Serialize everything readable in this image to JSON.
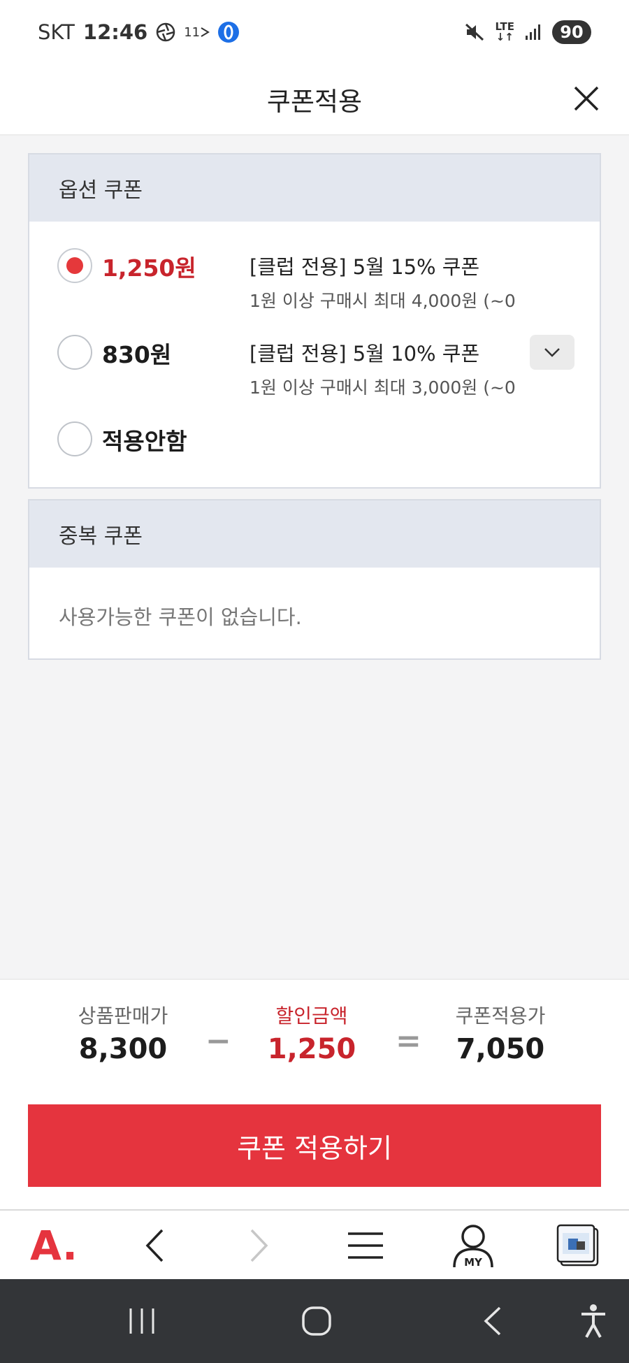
{
  "status_bar": {
    "carrier": "SKT",
    "time": "12:46",
    "app_icon_label": "11",
    "network": "LTE",
    "battery": "90",
    "icons": [
      "aperture-icon",
      "eleven-street-icon",
      "opera-icon",
      "mute-icon",
      "lte-icon",
      "signal-icon",
      "battery-icon"
    ]
  },
  "header": {
    "title": "쿠폰적용",
    "close_icon": "close-icon"
  },
  "option_coupon": {
    "title": "옵션 쿠폰",
    "options": [
      {
        "amount": "1,250원",
        "name": "[클럽 전용] 5월 15% 쿠폰",
        "desc": "1원 이상 구매시 최대 4,000원 (~0",
        "selected": true
      },
      {
        "amount": "830원",
        "name": "[클럽 전용] 5월 10% 쿠폰",
        "desc": "1원 이상 구매시 최대 3,000원 (~0",
        "selected": false
      },
      {
        "amount": "적용안함",
        "name": "",
        "desc": "",
        "selected": false
      }
    ]
  },
  "duplicate_coupon": {
    "title": "중복 쿠폰",
    "empty_message": "사용가능한 쿠폰이 없습니다."
  },
  "summary": {
    "sale_price_label": "상품판매가",
    "sale_price": "8,300",
    "minus": "−",
    "discount_label": "할인금액",
    "discount": "1,250",
    "equals": "=",
    "final_label": "쿠폰적용가",
    "final_price": "7,050"
  },
  "apply_button": "쿠폰 적용하기",
  "browser_bar": {
    "logo": "A",
    "my_label": "MY"
  },
  "colors": {
    "accent": "#e5343e",
    "accent_text": "#c8242c",
    "panel_header": "#e3e7ef",
    "background": "#f4f4f5",
    "nav_bar": "#333538"
  }
}
